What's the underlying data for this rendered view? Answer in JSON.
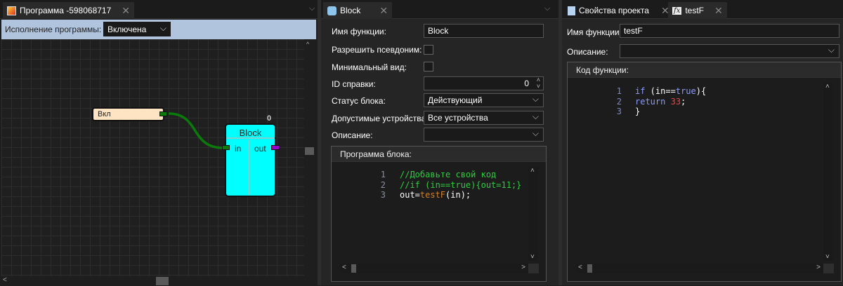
{
  "left": {
    "tab_title": "Программа -598068717",
    "toolbar_label": "Исполнение программы:",
    "execution_value": "Включена",
    "nodes": {
      "input_node": "Вкл",
      "block_title": "Block",
      "block_counter": "0",
      "port_in": "in",
      "port_out": "out"
    },
    "colors": {
      "toolbar": "#b0c4de",
      "block": "#00ffff",
      "input_node": "#ffe4c4",
      "wire": "#008000"
    }
  },
  "middle": {
    "tab_title": "Block",
    "form": {
      "name_label": "Имя функции:",
      "name_value": "Block",
      "alias_label": "Разрешить псевдоним:",
      "minimal_label": "Минимальный вид:",
      "help_id_label": "ID справки:",
      "help_id_value": "0",
      "status_label": "Статус блока:",
      "status_value": "Действующий",
      "devices_label": "Допустимые устройства:",
      "devices_value": "Все устройства",
      "description_label": "Описание:",
      "description_value": ""
    },
    "program_header": "Программа блока:",
    "code": {
      "line_numbers": [
        "1",
        "2",
        "3"
      ],
      "line1": "//Добавьте свой код",
      "line2": "//if (in==true){out=11;}",
      "line3_a": "out=",
      "line3_b": "testF",
      "line3_c": "(in);"
    }
  },
  "right": {
    "tabs": [
      "Свойства проекта",
      "testF"
    ],
    "form": {
      "name_label": "Имя функции:",
      "name_value": "testF",
      "description_label": "Описание:",
      "description_value": ""
    },
    "code_header": "Код функции:",
    "code": {
      "line_numbers": [
        "1",
        "2",
        "3"
      ],
      "l1_kw": "if",
      "l1_a": " (in==",
      "l1_kw2": "true",
      "l1_b": "){",
      "l2_kw": "return",
      "l2_num": "33",
      "l2_end": ";",
      "l3": "}"
    }
  }
}
